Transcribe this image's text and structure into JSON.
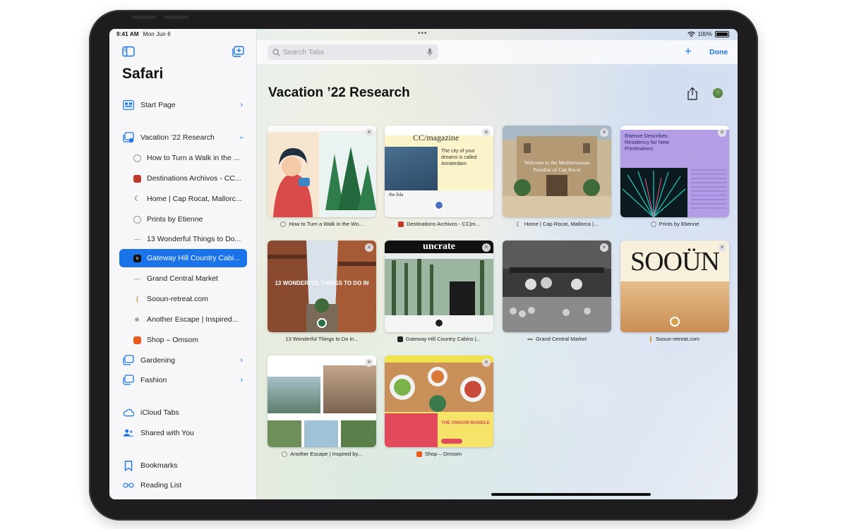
{
  "status": {
    "time": "9:41 AM",
    "date": "Mon Jun 6",
    "battery": "100%"
  },
  "sidebar": {
    "title": "Safari",
    "items": [
      {
        "label": "Start Page"
      },
      {
        "label": "Vacation ’22 Research"
      },
      {
        "label": "How to Turn a Walk in the ..."
      },
      {
        "label": "Destinations Archivos - CC..."
      },
      {
        "label": "Home | Cap Rocat, Mallorc..."
      },
      {
        "label": "Prints by Etienne"
      },
      {
        "label": "13 Wonderful Things to Do..."
      },
      {
        "label": "Gateway Hill Country Cabi..."
      },
      {
        "label": "Grand Central Market"
      },
      {
        "label": "Sooun-retreat.com"
      },
      {
        "label": "Another Escape | Inspired..."
      },
      {
        "label": "Shop – Omsom"
      },
      {
        "label": "Gardening"
      },
      {
        "label": "Fashion"
      },
      {
        "label": "iCloud Tabs"
      },
      {
        "label": "Shared with You"
      },
      {
        "label": "Bookmarks"
      },
      {
        "label": "Reading List"
      }
    ]
  },
  "toolbar": {
    "search_placeholder": "Search Tabs",
    "add_label": "+",
    "done_label": "Done"
  },
  "group": {
    "title": "Vacation ’22 Research"
  },
  "tabs": [
    {
      "caption": "How to Turn a Walk in the Wo...",
      "fav_color": "#8a8a8a"
    },
    {
      "caption": "Destinations Archivos - CC|m...",
      "fav_color": "#c0392b",
      "thumb_text": "CC/magazine",
      "thumb_sub": "The city of your dreams is called Amsterdam",
      "thumb_brand": "the Isla"
    },
    {
      "caption": "Home | Cap Rocat, Mallorca |...",
      "fav_color": "#5a4a3a",
      "thumb_text": "Welcome to the Mediterranean Paradise of Cap Rocat"
    },
    {
      "caption": "Prints by Etienne",
      "fav_color": "#bbbbbb",
      "thumb_text": "Etienne Describes Residency for New Printmakers"
    },
    {
      "caption": "13 Wonderful Things to Do in...",
      "fav_color": "#2c6e49",
      "thumb_text": "13 WONDERFUL THINGS TO DO IN"
    },
    {
      "caption": "Gateway Hill Country Cabins |...",
      "fav_color": "#222222",
      "thumb_text": "uncrate"
    },
    {
      "caption": "Grand Central Market",
      "fav_color": "#777777"
    },
    {
      "caption": "Sooun-retreat.com",
      "fav_color": "#d4a24c",
      "thumb_text": "SOOÜN"
    },
    {
      "caption": "Another Escape | Inspired by...",
      "fav_color": "#9a9a9a"
    },
    {
      "caption": "Shop – Omsom",
      "fav_color": "#e85a1e",
      "thumb_text": "THE OMSOM BUNDLE"
    }
  ],
  "colors": {
    "accent": "#1a73e8",
    "sidebar_bg": "#f7f7f9"
  }
}
